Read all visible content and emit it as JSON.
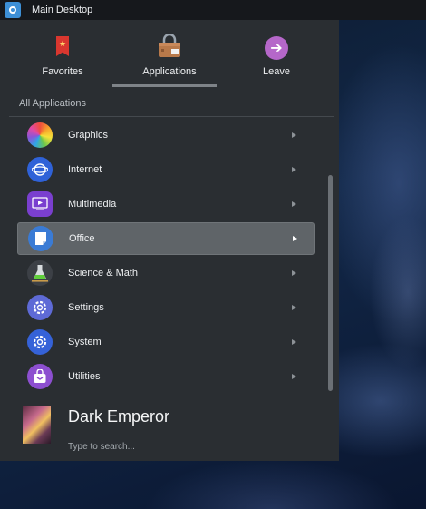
{
  "panel": {
    "title": "Main Desktop",
    "launcher_icon": "kde-launcher-icon"
  },
  "tabs": [
    {
      "label": "Favorites",
      "icon": "bookmark-icon",
      "active": false
    },
    {
      "label": "Applications",
      "icon": "applications-icon",
      "active": true
    },
    {
      "label": "Leave",
      "icon": "leave-arrow-icon",
      "active": false
    }
  ],
  "section": {
    "header": "All Applications"
  },
  "apps": [
    {
      "label": "Graphics",
      "icon": "color-wheel-icon",
      "selected": false
    },
    {
      "label": "Internet",
      "icon": "globe-icon",
      "selected": false
    },
    {
      "label": "Multimedia",
      "icon": "media-player-icon",
      "selected": false
    },
    {
      "label": "Office",
      "icon": "document-icon",
      "selected": true
    },
    {
      "label": "Science & Math",
      "icon": "flask-icon",
      "selected": false
    },
    {
      "label": "Settings",
      "icon": "settings-gear-icon",
      "selected": false
    },
    {
      "label": "System",
      "icon": "system-gear-icon",
      "selected": false
    },
    {
      "label": "Utilities",
      "icon": "briefcase-icon",
      "selected": false
    }
  ],
  "user": {
    "name": "Dark Emperor"
  },
  "search": {
    "placeholder": "Type to search...",
    "value": ""
  }
}
